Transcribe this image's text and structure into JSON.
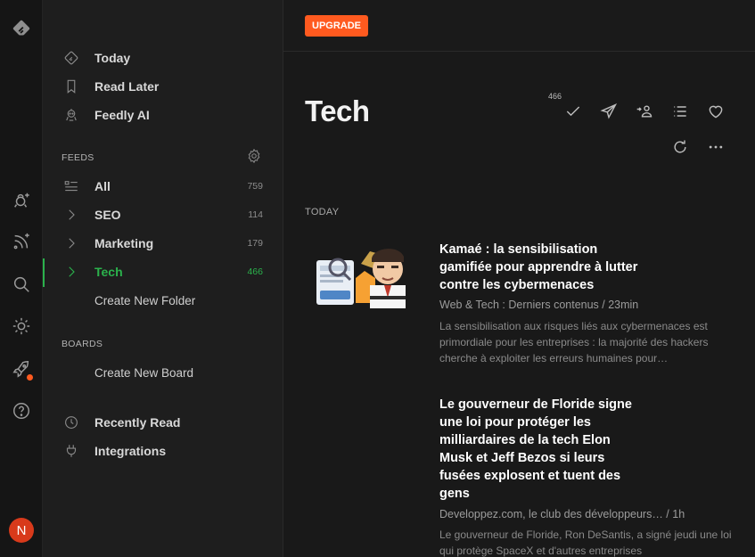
{
  "rail": {
    "icons": [
      "feedly-logo-icon",
      "add-source-icon",
      "add-feed-icon",
      "search-icon",
      "theme-icon",
      "rocket-icon",
      "help-icon"
    ],
    "avatar_initial": "N",
    "accent": "#ff5a1f"
  },
  "sidebar": {
    "today": "Today",
    "read_later": "Read Later",
    "feedly_ai": "Feedly AI",
    "feeds_title": "FEEDS",
    "feeds": [
      {
        "label": "All",
        "count": "759"
      },
      {
        "label": "SEO",
        "count": "114"
      },
      {
        "label": "Marketing",
        "count": "179"
      },
      {
        "label": "Tech",
        "count": "466"
      }
    ],
    "create_folder": "Create New Folder",
    "boards_title": "BOARDS",
    "create_board": "Create New Board",
    "recently_read": "Recently Read",
    "integrations": "Integrations",
    "active_color": "#2bb24c"
  },
  "main": {
    "upgrade_label": "UPGRADE",
    "title": "Tech",
    "unread_badge": "466",
    "section_today": "TODAY",
    "articles": [
      {
        "title": "Kamaé : la sensibilisation gamifiée pour apprendre à lutter contre les cybermenaces",
        "meta": "Web & Tech : Derniers contenus / 23min",
        "excerpt": "La sensibilisation aux risques liés aux cybermenaces est primordiale pour les entreprises : la majorité des hackers cherche à exploiter les erreurs humaines pour…"
      },
      {
        "title": "Le gouverneur de Floride signe une loi pour protéger les milliardaires de la tech Elon Musk et Jeff Bezos si leurs fusées explosent et tuent des gens",
        "meta": "Developpez.com, le club des développeurs… / 1h",
        "excerpt": "Le gouverneur de Floride, Ron DeSantis, a signé jeudi une loi qui protège SpaceX et d'autres entreprises"
      }
    ]
  }
}
